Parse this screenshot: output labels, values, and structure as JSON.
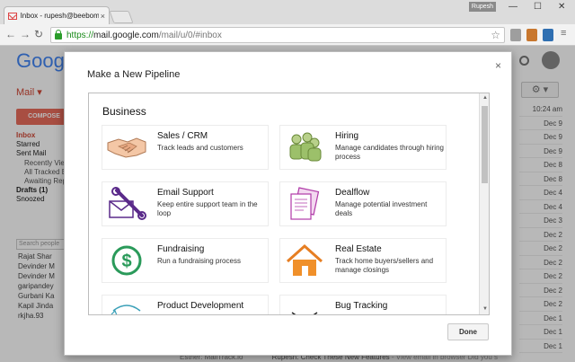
{
  "browser": {
    "tab_title": "Inbox - rupesh@beebom.c",
    "tab_close": "×",
    "user_chip": "Rupesh",
    "window_controls": [
      "—",
      "☐",
      "✕"
    ],
    "url_scheme": "https://",
    "url_host": "mail.google.com",
    "url_path": "/mail/u/0/#inbox",
    "star": "☆"
  },
  "gmail": {
    "logo": "Google",
    "mail_label": "Mail ▾",
    "compose": "COMPOSE",
    "nav": [
      {
        "label": "Inbox",
        "kind": "active"
      },
      {
        "label": "Starred",
        "kind": ""
      },
      {
        "label": "Sent Mail",
        "kind": ""
      },
      {
        "label": "Recently Vie",
        "kind": "sub"
      },
      {
        "label": "All Tracked E",
        "kind": "sub"
      },
      {
        "label": "Awaiting Rep",
        "kind": "sub"
      },
      {
        "label": "Drafts (1)",
        "kind": "bold"
      },
      {
        "label": "Snoozed",
        "kind": ""
      }
    ],
    "people_placeholder": "Search people",
    "contacts": [
      "Rajat Shar",
      "Devinder M",
      "Devinder M",
      "garipandey",
      "Gurbani Ka",
      "Kapil Jinda",
      "rkjha.93"
    ],
    "dates": [
      "10:24 am",
      "Dec 9",
      "Dec 9",
      "Dec 9",
      "Dec 8",
      "Dec 8",
      "Dec 4",
      "Dec 4",
      "Dec 3",
      "Dec 2",
      "Dec 2",
      "Dec 2",
      "Dec 2",
      "Dec 2",
      "Dec 2",
      "Dec 1",
      "Dec 1",
      "Dec 1"
    ],
    "gear": "⚙ ▾",
    "bottom_sender": "Esther: MailTrack.io",
    "bottom_subject": "Rupesh: Check These New Features",
    "bottom_snippet": " - View email in browser Did you s"
  },
  "modal": {
    "title": "Make a New Pipeline",
    "close": "×",
    "section": "Business",
    "done": "Done",
    "cards": [
      {
        "title": "Sales / CRM",
        "desc": "Track leads and customers",
        "icon": "handshake-icon"
      },
      {
        "title": "Hiring",
        "desc": "Manage candidates through hiring process",
        "icon": "people-icon"
      },
      {
        "title": "Email Support",
        "desc": "Keep entire support team in the loop",
        "icon": "envelope-wrench-icon"
      },
      {
        "title": "Dealflow",
        "desc": "Manage potential investment deals",
        "icon": "documents-icon"
      },
      {
        "title": "Fundraising",
        "desc": "Run a fundraising process",
        "icon": "dollar-icon"
      },
      {
        "title": "Real Estate",
        "desc": "Track home buyers/sellers and manage closings",
        "icon": "house-icon"
      },
      {
        "title": "Product Development",
        "desc": "",
        "icon": "product-cycle-icon"
      },
      {
        "title": "Bug Tracking",
        "desc": "",
        "icon": "bug-icon"
      }
    ]
  }
}
